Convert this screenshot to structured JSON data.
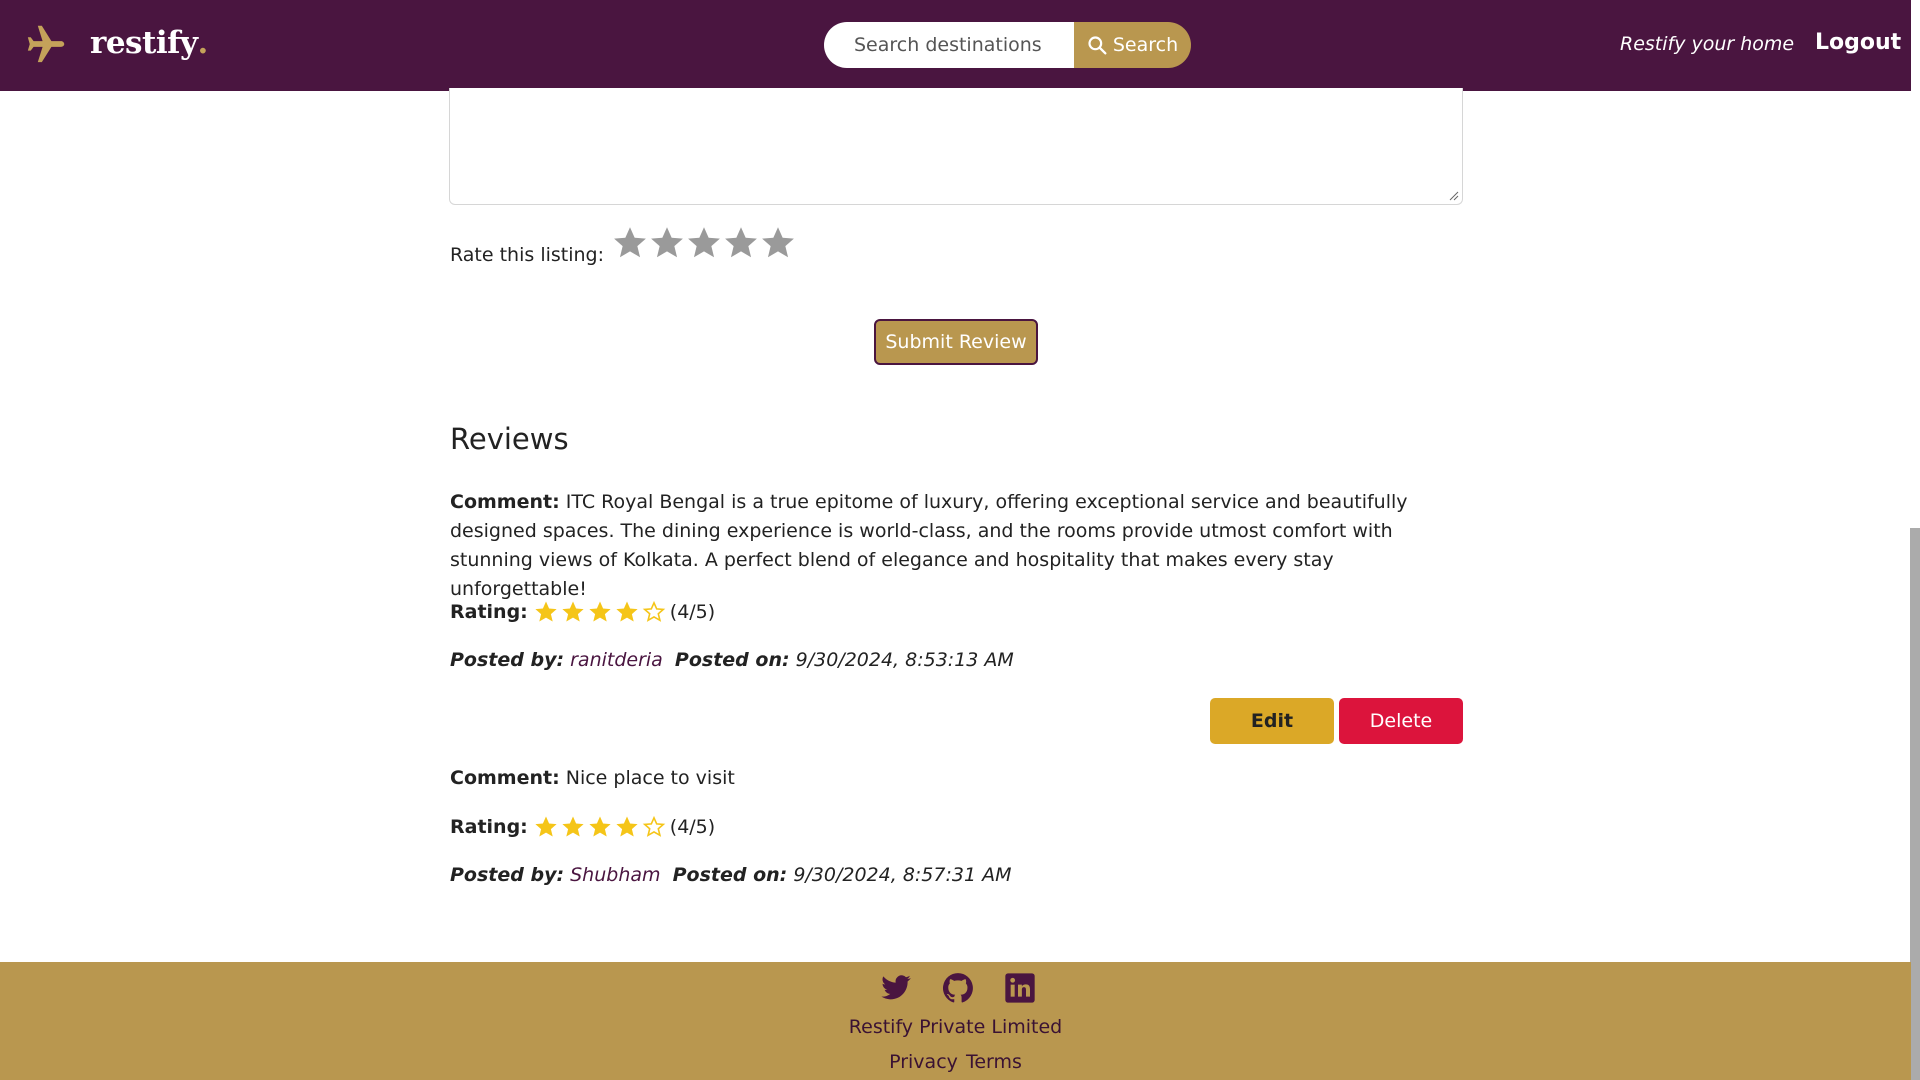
{
  "navbar": {
    "brand_name": "restify",
    "brand_dot": ".",
    "search_placeholder": "Search destinations",
    "search_button": "Search",
    "host_link": "Restify your home",
    "logout": "Logout"
  },
  "review_form": {
    "rate_label": "Rate this listing:",
    "rating_value": 0,
    "rating_max": 5,
    "submit_label": "Submit Review"
  },
  "reviews": {
    "heading": "Reviews",
    "comment_label": "Comment:",
    "rating_label": "Rating:",
    "posted_by_label": "Posted by:",
    "posted_on_label": "Posted on:",
    "items": [
      {
        "comment": "ITC Royal Bengal is a true epitome of luxury, offering exceptional service and beautifully designed spaces. The dining experience is world-class, and the rooms provide utmost comfort with stunning views of Kolkata. A perfect blend of elegance and hospitality that makes every stay unforgettable!",
        "rating": 4,
        "rating_text": "(4/5)",
        "author": "ranitderia",
        "posted_on": "9/30/2024, 8:53:13 AM",
        "edit_label": "Edit",
        "delete_label": "Delete"
      },
      {
        "comment": "Nice place to visit",
        "rating": 4,
        "rating_text": "(4/5)",
        "author": "Shubham",
        "posted_on": "9/30/2024, 8:57:31 AM"
      }
    ]
  },
  "footer": {
    "socials": [
      "twitter-icon",
      "github-icon",
      "linkedin-icon"
    ],
    "company": "Restify Private Limited",
    "privacy": "Privacy",
    "terms": "Terms"
  },
  "colors": {
    "navbar": "#4a1540",
    "accent_gold": "#b9974f",
    "edit": "#dba827",
    "delete": "#dc143c",
    "star_filled": "#f5c518",
    "star_empty_rating": "#9a9a9a"
  }
}
